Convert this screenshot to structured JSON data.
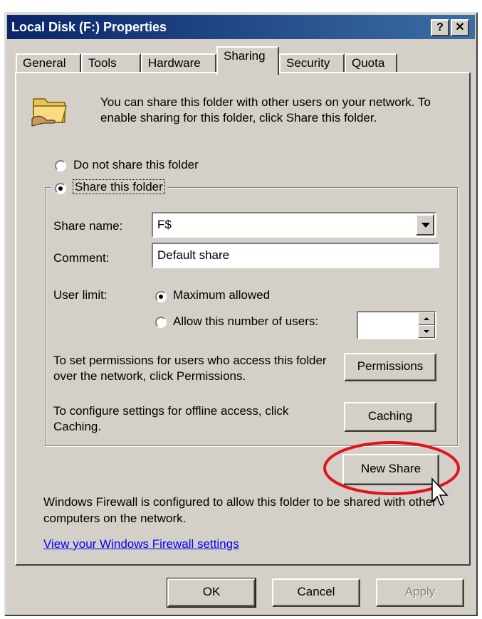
{
  "window": {
    "title": "Local Disk (F:) Properties",
    "help_button": "?",
    "close_button": "✕"
  },
  "tabs": [
    {
      "label": "General"
    },
    {
      "label": "Tools"
    },
    {
      "label": "Hardware"
    },
    {
      "label": "Sharing",
      "active": true
    },
    {
      "label": "Security"
    },
    {
      "label": "Quota"
    }
  ],
  "sharing": {
    "intro_text": "You can share this folder with other users on your network.  To enable sharing for this folder, click Share this folder.",
    "do_not_share_label": "Do not share this folder",
    "share_label": "Share this folder",
    "share_name_label": "Share name:",
    "share_name_value": "F$",
    "comment_label": "Comment:",
    "comment_value": "Default share",
    "user_limit_label": "User limit:",
    "max_allowed_label": "Maximum allowed",
    "allow_users_label": "Allow this number of users:",
    "permissions_text": "To set permissions for users who access this folder over the network, click Permissions.",
    "permissions_button": "Permissions",
    "caching_text": "To configure settings for offline access, click Caching.",
    "caching_button": "Caching",
    "new_share_button": "New Share",
    "firewall_text": "Windows Firewall is configured to allow this folder to be shared with other computers on the network.",
    "firewall_link": "View your Windows Firewall settings"
  },
  "footer": {
    "ok": "OK",
    "cancel": "Cancel",
    "apply": "Apply"
  },
  "colors": {
    "highlight_ellipse": "#e0141e",
    "titlebar": "#0a246a"
  }
}
